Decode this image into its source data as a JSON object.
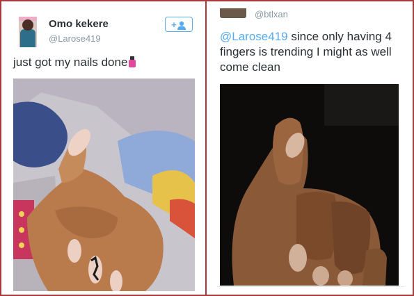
{
  "left_tweet": {
    "display_name": "Omo kekere",
    "handle": "@Larose419",
    "follow_label": "+",
    "text": "just got my nails done",
    "emoji": "nail-polish-icon"
  },
  "right_tweet": {
    "handle": "@btlxan",
    "mention": "@Larose419",
    "text": " since only having 4 fingers is trending I might as well come clean"
  },
  "colors": {
    "border": "#a83a3a",
    "accent": "#55acee",
    "text": "#292f33",
    "muted": "#8899a6"
  }
}
